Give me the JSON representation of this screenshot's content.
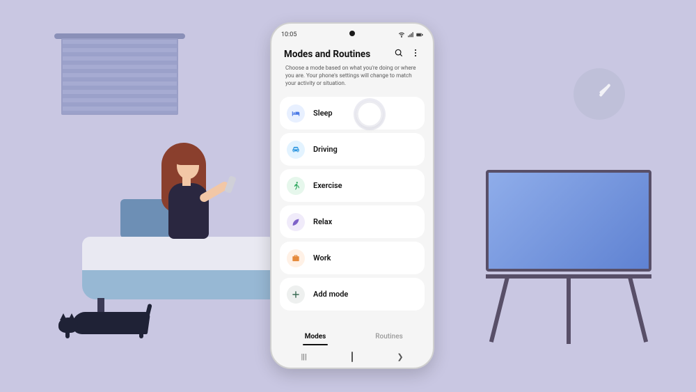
{
  "statusbar": {
    "time": "10:05"
  },
  "screen": {
    "title": "Modes and Routines",
    "subtitle": "Choose a mode based on what you're doing or where you are. Your phone's settings will change to match your activity or situation."
  },
  "modes": [
    {
      "label": "Sleep",
      "icon": "bed-icon",
      "bg": "#e8f0ff",
      "fg": "#4a79e6"
    },
    {
      "label": "Driving",
      "icon": "car-icon",
      "bg": "#e3f3ff",
      "fg": "#2f97e0"
    },
    {
      "label": "Exercise",
      "icon": "run-icon",
      "bg": "#e6f7ec",
      "fg": "#2fa85f"
    },
    {
      "label": "Relax",
      "icon": "leaf-icon",
      "bg": "#f0ebfa",
      "fg": "#7f63c9"
    },
    {
      "label": "Work",
      "icon": "work-icon",
      "bg": "#fff1e6",
      "fg": "#e58a3c"
    },
    {
      "label": "Add mode",
      "icon": "plus-icon",
      "bg": "#eef0ef",
      "fg": "#3a6b54"
    }
  ],
  "tabs": {
    "active": "Modes",
    "inactive": "Routines"
  }
}
